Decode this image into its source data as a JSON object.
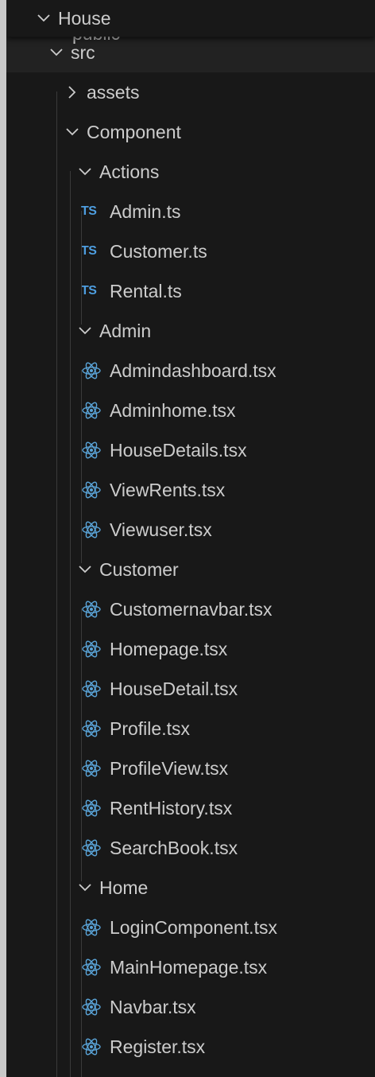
{
  "explorer": {
    "root": {
      "label": "House",
      "expanded": true
    },
    "partial_item": {
      "label": "public"
    },
    "items": [
      {
        "label": "src",
        "type": "folder",
        "expanded": true,
        "depth": 1,
        "selected": true
      },
      {
        "label": "assets",
        "type": "folder",
        "expanded": false,
        "depth": 2
      },
      {
        "label": "Component",
        "type": "folder",
        "expanded": true,
        "depth": 2
      },
      {
        "label": "Actions",
        "type": "folder",
        "expanded": true,
        "depth": 3
      },
      {
        "label": "Admin.ts",
        "type": "ts",
        "depth": 4
      },
      {
        "label": "Customer.ts",
        "type": "ts",
        "depth": 4
      },
      {
        "label": "Rental.ts",
        "type": "ts",
        "depth": 4
      },
      {
        "label": "Admin",
        "type": "folder",
        "expanded": true,
        "depth": 3
      },
      {
        "label": "Admindashboard.tsx",
        "type": "tsx",
        "depth": 4
      },
      {
        "label": "Adminhome.tsx",
        "type": "tsx",
        "depth": 4
      },
      {
        "label": "HouseDetails.tsx",
        "type": "tsx",
        "depth": 4
      },
      {
        "label": "ViewRents.tsx",
        "type": "tsx",
        "depth": 4
      },
      {
        "label": "Viewuser.tsx",
        "type": "tsx",
        "depth": 4
      },
      {
        "label": "Customer",
        "type": "folder",
        "expanded": true,
        "depth": 3
      },
      {
        "label": "Customernavbar.tsx",
        "type": "tsx",
        "depth": 4
      },
      {
        "label": "Homepage.tsx",
        "type": "tsx",
        "depth": 4
      },
      {
        "label": "HouseDetail.tsx",
        "type": "tsx",
        "depth": 4
      },
      {
        "label": "Profile.tsx",
        "type": "tsx",
        "depth": 4
      },
      {
        "label": "ProfileView.tsx",
        "type": "tsx",
        "depth": 4
      },
      {
        "label": "RentHistory.tsx",
        "type": "tsx",
        "depth": 4
      },
      {
        "label": "SearchBook.tsx",
        "type": "tsx",
        "depth": 4
      },
      {
        "label": "Home",
        "type": "folder",
        "expanded": true,
        "depth": 3
      },
      {
        "label": "LoginComponent.tsx",
        "type": "tsx",
        "depth": 4
      },
      {
        "label": "MainHomepage.tsx",
        "type": "tsx",
        "depth": 4
      },
      {
        "label": "Navbar.tsx",
        "type": "tsx",
        "depth": 4
      },
      {
        "label": "Register.tsx",
        "type": "tsx",
        "depth": 4
      }
    ],
    "icons": {
      "ts_text": "TS",
      "ts_color": "#4e9ee0",
      "react_color": "#5aa4d8",
      "chevron_color": "#cccccc"
    },
    "colors": {
      "background": "#181818",
      "selected_row": "#222222",
      "text": "#cccccc",
      "outer_frame": "#c9c9c9"
    }
  }
}
